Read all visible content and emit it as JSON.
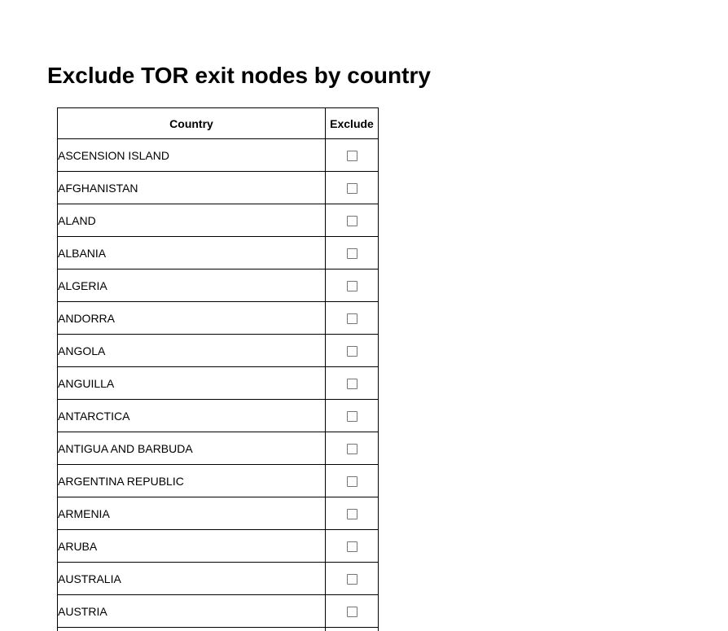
{
  "page": {
    "title": "Exclude TOR exit nodes by country"
  },
  "table": {
    "headers": {
      "country": "Country",
      "exclude": "Exclude"
    },
    "rows": [
      {
        "country": "ASCENSION ISLAND",
        "excluded": false
      },
      {
        "country": "AFGHANISTAN",
        "excluded": false
      },
      {
        "country": "ALAND",
        "excluded": false
      },
      {
        "country": "ALBANIA",
        "excluded": false
      },
      {
        "country": "ALGERIA",
        "excluded": false
      },
      {
        "country": "ANDORRA",
        "excluded": false
      },
      {
        "country": "ANGOLA",
        "excluded": false
      },
      {
        "country": "ANGUILLA",
        "excluded": false
      },
      {
        "country": "ANTARCTICA",
        "excluded": false
      },
      {
        "country": "ANTIGUA AND BARBUDA",
        "excluded": false
      },
      {
        "country": "ARGENTINA REPUBLIC",
        "excluded": false
      },
      {
        "country": "ARMENIA",
        "excluded": false
      },
      {
        "country": "ARUBA",
        "excluded": false
      },
      {
        "country": "AUSTRALIA",
        "excluded": false
      },
      {
        "country": "AUSTRIA",
        "excluded": false
      },
      {
        "country": "",
        "excluded": false
      }
    ]
  }
}
